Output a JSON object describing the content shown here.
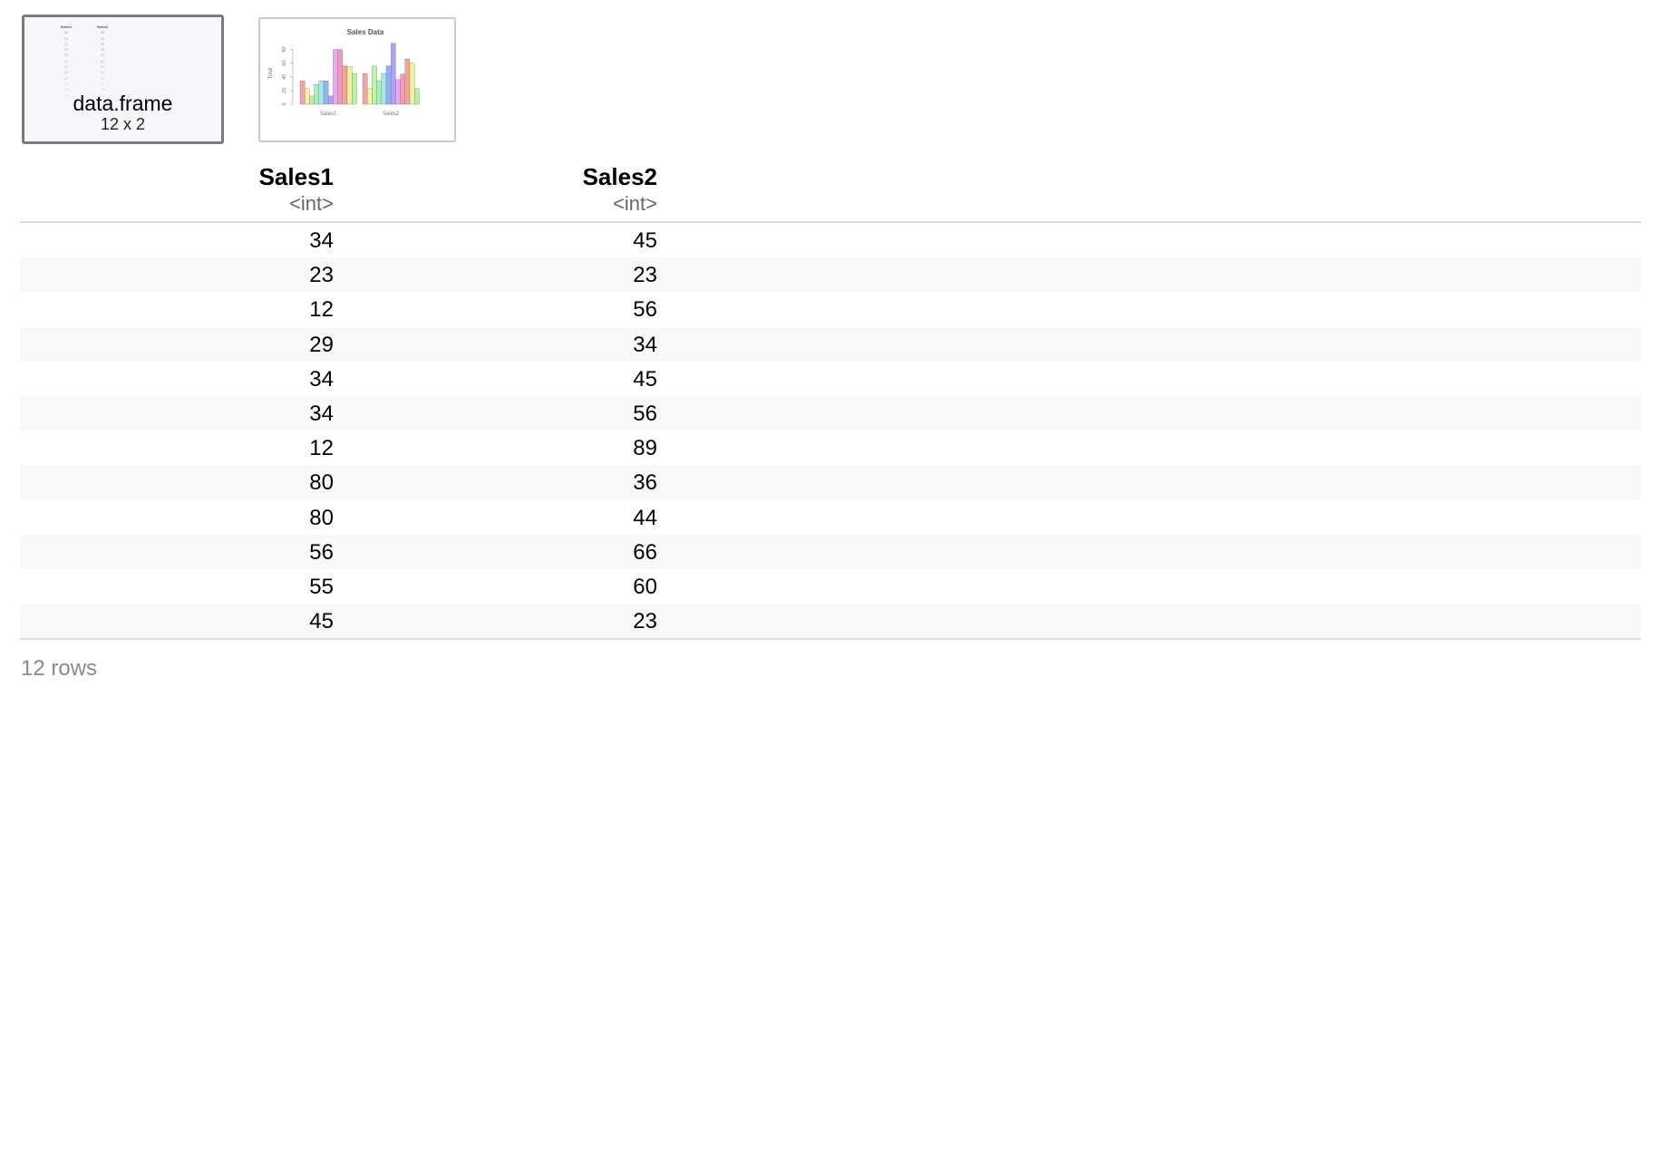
{
  "thumbnails": {
    "data_frame": {
      "title": "data.frame",
      "subtitle": "12 x 2",
      "mini_headers": [
        "Sales1",
        "Sales2"
      ]
    },
    "plot": {
      "chart_data": {
        "type": "bar",
        "title": "Sales Data",
        "xlabel": "",
        "ylabel": "Total",
        "categories": [
          "Sales1",
          "Sales2"
        ],
        "ylim": [
          0,
          90
        ],
        "y_ticks": [
          "0",
          "20",
          "40",
          "60",
          "80"
        ],
        "groups": [
          {
            "name": "Sales1",
            "values": [
              34,
              23,
              12,
              29,
              34,
              34,
              12,
              80,
              80,
              56,
              55,
              45
            ]
          },
          {
            "name": "Sales2",
            "values": [
              45,
              23,
              56,
              34,
              45,
              56,
              89,
              36,
              44,
              66,
              60,
              23
            ]
          }
        ],
        "bar_colors": [
          "#f4a3a3",
          "#f6f3a2",
          "#b9f4a7",
          "#a8f1bb",
          "#a8e6ee",
          "#8fb4f4",
          "#a9a3f4",
          "#eaa7f3",
          "#f39bb9",
          "#f4a78e",
          "#eef29f",
          "#b7f4a1"
        ]
      }
    }
  },
  "table": {
    "columns": [
      {
        "name": "Sales1",
        "type": "<int>"
      },
      {
        "name": "Sales2",
        "type": "<int>"
      }
    ],
    "rows": [
      [
        "34",
        "45"
      ],
      [
        "23",
        "23"
      ],
      [
        "12",
        "56"
      ],
      [
        "29",
        "34"
      ],
      [
        "34",
        "45"
      ],
      [
        "34",
        "56"
      ],
      [
        "12",
        "89"
      ],
      [
        "80",
        "36"
      ],
      [
        "80",
        "44"
      ],
      [
        "56",
        "66"
      ],
      [
        "55",
        "60"
      ],
      [
        "45",
        "23"
      ]
    ]
  },
  "footer": {
    "row_count_label": "12 rows"
  }
}
